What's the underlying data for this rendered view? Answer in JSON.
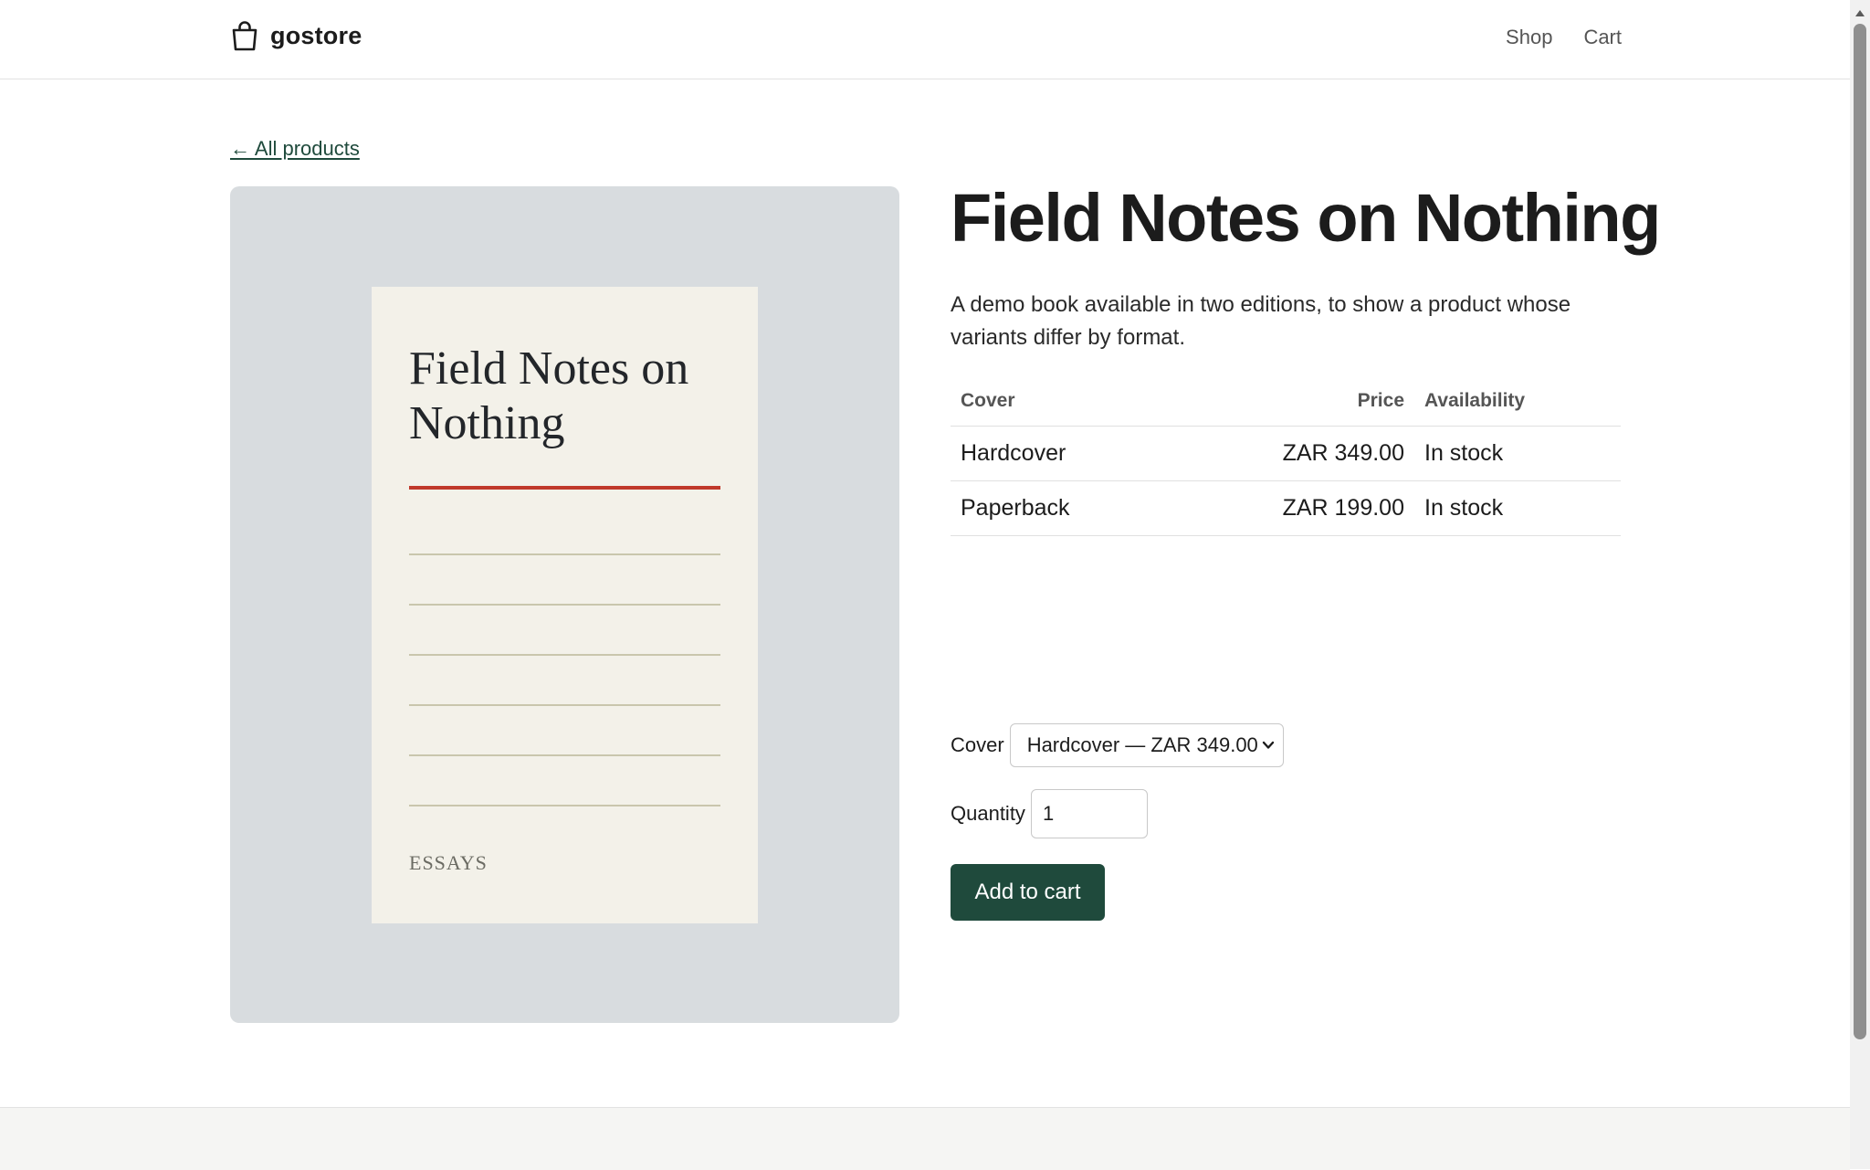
{
  "header": {
    "brand": "gostore",
    "nav": [
      {
        "label": "Shop"
      },
      {
        "label": "Cart"
      }
    ]
  },
  "back_link": "← All products",
  "product": {
    "title": "Field Notes on Nothing",
    "description": "A demo book available in two editions, to show a product whose variants differ by format.",
    "cover_art": {
      "title": "Field Notes on Nothing",
      "tag": "ESSAYS",
      "rule_color": "#c0392b"
    }
  },
  "variants_table": {
    "headers": [
      "Cover",
      "Price",
      "Availability"
    ],
    "rows": [
      [
        "Hardcover",
        "ZAR 349.00",
        "In stock"
      ],
      [
        "Paperback",
        "ZAR 199.00",
        "In stock"
      ]
    ]
  },
  "form": {
    "cover_label": "Cover",
    "cover_selected": "Hardcover — ZAR 349.00",
    "quantity_label": "Quantity",
    "quantity_value": "1",
    "add_button": "Add to cart"
  },
  "colors": {
    "accent": "#1f4a3c",
    "media_bg": "#d8dcdf",
    "cover_bg": "#f3f1e9"
  },
  "icons": {
    "brand": "shopping-bag-icon",
    "select": "chevron-down-icon"
  }
}
